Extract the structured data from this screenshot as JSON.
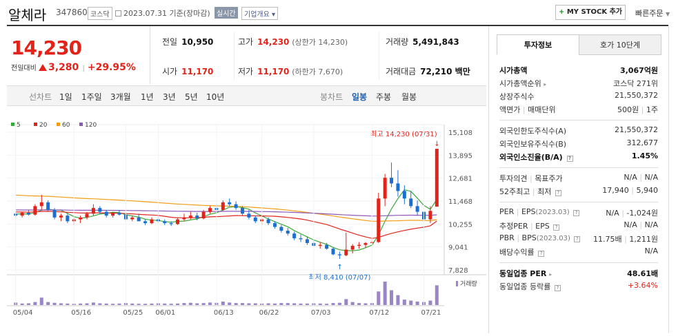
{
  "header": {
    "stock_name": "알체라",
    "stock_code": "347860",
    "market_badge": "코스닥",
    "date_text": "2023.07.31 기준(장마감)",
    "realtime_badge": "실시간",
    "company_overview": "기업개요",
    "mystock_plus": "+",
    "mystock_label": "MY STOCK 추가",
    "quick_order": "빠른주문"
  },
  "price": {
    "current": "14,230",
    "change_label": "전일대비",
    "change": "3,280",
    "change_pct": "+29.95%"
  },
  "stats": {
    "prev_label": "전일",
    "prev": "10,950",
    "high_label": "고가",
    "high": "14,230",
    "high_note": "(상한가 14,230)",
    "volume_label": "거래량",
    "volume": "5,491,843",
    "open_label": "시가",
    "open": "11,170",
    "low_label": "저가",
    "low": "11,170",
    "low_note": "(하한가 7,670)",
    "amount_label": "거래대금",
    "amount": "72,210 백만"
  },
  "chart_controls": {
    "line_chart": "선차트",
    "periods": [
      "1일",
      "1주일",
      "3개월",
      "1년",
      "3년",
      "5년",
      "10년"
    ],
    "candle_chart": "봉차트",
    "candle_periods": [
      "일봉",
      "주봉",
      "월봉"
    ],
    "selected_candle": "일봉"
  },
  "chart_data": {
    "type": "candlestick",
    "legend": [
      {
        "name": "5",
        "color": "#3aa83a"
      },
      {
        "name": "20",
        "color": "#e2231a"
      },
      {
        "name": "60",
        "color": "#f39c12"
      },
      {
        "name": "120",
        "color": "#8e58b8"
      }
    ],
    "y_ticks": [
      "15,108",
      "13,895",
      "12,681",
      "11,468",
      "10,255",
      "9,041",
      "7,828"
    ],
    "ylim": [
      7828,
      15108
    ],
    "x_ticks": [
      "05/04",
      "05/16",
      "05/25",
      "06/01",
      "06/13",
      "06/22",
      "07/03",
      "07/12",
      "07/21"
    ],
    "high_annotation": "최고 14,230 (07/31)",
    "low_annotation": "최저 8,410 (07/07)",
    "volume_label": "거래량",
    "candles": [
      [
        10800,
        10900,
        10600,
        10700
      ],
      [
        10700,
        10900,
        10600,
        10850
      ],
      [
        10850,
        11000,
        10700,
        10750
      ],
      [
        10750,
        11300,
        10700,
        11200
      ],
      [
        11200,
        11800,
        11000,
        11400
      ],
      [
        11400,
        11500,
        10900,
        11000
      ],
      [
        11000,
        11100,
        10500,
        10600
      ],
      [
        10600,
        10800,
        10400,
        10700
      ],
      [
        10700,
        10800,
        10300,
        10400
      ],
      [
        10400,
        10600,
        10200,
        10500
      ],
      [
        10500,
        10700,
        10300,
        10600
      ],
      [
        10600,
        10900,
        10500,
        10800
      ],
      [
        10800,
        11300,
        10700,
        11100
      ],
      [
        11100,
        11200,
        10800,
        10900
      ],
      [
        10900,
        11000,
        10600,
        10700
      ],
      [
        10700,
        10900,
        10600,
        10850
      ],
      [
        10850,
        11000,
        10700,
        10750
      ],
      [
        10750,
        10800,
        10400,
        10500
      ],
      [
        10500,
        10700,
        10400,
        10600
      ],
      [
        10600,
        10800,
        10500,
        10400
      ],
      [
        10400,
        10500,
        10200,
        10300
      ],
      [
        10300,
        10600,
        10250,
        10500
      ],
      [
        10500,
        10700,
        10300,
        10400
      ],
      [
        10400,
        10500,
        10200,
        10300
      ],
      [
        10300,
        10400,
        10150,
        10250
      ],
      [
        10250,
        10600,
        10200,
        10500
      ],
      [
        10500,
        10800,
        10400,
        10600
      ],
      [
        10600,
        10900,
        10500,
        10700
      ],
      [
        10700,
        10850,
        10450,
        10550
      ],
      [
        10550,
        11000,
        10500,
        10900
      ],
      [
        10900,
        11200,
        10800,
        11100
      ],
      [
        11100,
        11300,
        10900,
        11000
      ],
      [
        11000,
        11500,
        10950,
        11400
      ],
      [
        11400,
        11600,
        11200,
        11300
      ],
      [
        11300,
        11450,
        11000,
        11100
      ],
      [
        11100,
        11200,
        10700,
        10800
      ],
      [
        10800,
        11000,
        10500,
        10600
      ],
      [
        10600,
        10700,
        10300,
        10400
      ],
      [
        10400,
        10700,
        10200,
        10500
      ],
      [
        10500,
        10600,
        10200,
        10300
      ],
      [
        10300,
        10400,
        10000,
        10100
      ],
      [
        10100,
        10200,
        9800,
        9900
      ],
      [
        9900,
        10050,
        9650,
        9750
      ],
      [
        9750,
        9850,
        9400,
        9500
      ],
      [
        9500,
        9700,
        9300,
        9450
      ],
      [
        9450,
        9600,
        9150,
        9250
      ],
      [
        9250,
        9400,
        9050,
        9100
      ],
      [
        9100,
        9300,
        8950,
        9150
      ],
      [
        9150,
        9250,
        8900,
        8950
      ],
      [
        8950,
        9000,
        8600,
        8650
      ],
      [
        8650,
        8800,
        8410,
        8600
      ],
      [
        8600,
        9800,
        8550,
        8900
      ],
      [
        8900,
        9200,
        8700,
        9100
      ],
      [
        9100,
        9300,
        8950,
        9150
      ],
      [
        9150,
        9300,
        9000,
        9250
      ],
      [
        9250,
        9450,
        9100,
        9300
      ],
      [
        9300,
        11900,
        9250,
        11600
      ],
      [
        11600,
        12900,
        11200,
        12700
      ],
      [
        12700,
        13500,
        12200,
        12400
      ],
      [
        12400,
        13100,
        11700,
        12000
      ],
      [
        12000,
        12300,
        11300,
        11600
      ],
      [
        11600,
        12000,
        11100,
        11200
      ],
      [
        11200,
        11500,
        10700,
        10900
      ],
      [
        10900,
        11100,
        10400,
        10500
      ],
      [
        10500,
        11200,
        10300,
        10950
      ],
      [
        11170,
        14230,
        11170,
        14230
      ]
    ],
    "volumes": [
      10,
      6,
      7,
      12,
      30,
      12,
      9,
      7,
      6,
      5,
      6,
      7,
      10,
      7,
      6,
      5,
      6,
      8,
      6,
      5,
      5,
      6,
      7,
      6,
      5,
      6,
      8,
      9,
      7,
      8,
      10,
      9,
      14,
      10,
      8,
      8,
      7,
      7,
      6,
      7,
      6,
      8,
      8,
      7,
      6,
      6,
      7,
      6,
      5,
      8,
      9,
      24,
      12,
      8,
      7,
      8,
      55,
      95,
      60,
      40,
      22,
      18,
      14,
      12,
      18,
      80
    ]
  },
  "side": {
    "tab_invest": "투자정보",
    "tab_hoga": "호가 10단계",
    "r1k": "시가총액",
    "r1v": "3,067억원",
    "r2k": "시가총액순위",
    "r2v": "코스닥 271위",
    "r3k": "상장주식수",
    "r3v": "21,550,372",
    "r4k": "액면가",
    "r4k2": "매매단위",
    "r4v": "500원",
    "r4v2": "1주",
    "r5k": "외국인한도주식수(A)",
    "r5v": "21,550,372",
    "r6k": "외국인보유주식수(B)",
    "r6v": "312,677",
    "r7k": "외국인소진율(B/A)",
    "r7v": "1.45%",
    "r8k": "투자의견",
    "r8k2": "목표주가",
    "r8v": "N/A",
    "r8v2": "N/A",
    "r9k": "52주최고",
    "r9k2": "최저",
    "r9v": "17,940",
    "r9v2": "5,940",
    "r10k": "PER",
    "r10k2": "EPS",
    "r10y": "(2023.03)",
    "r10v": "N/A",
    "r10v2": "-1,024원",
    "r11k": "추정PER",
    "r11k2": "EPS",
    "r11v": "N/A",
    "r11v2": "N/A",
    "r12k": "PBR",
    "r12k2": "BPS",
    "r12y": "(2023.03)",
    "r12v": "11.75배",
    "r12v2": "1,211원",
    "r13k": "배당수익률",
    "r13v": "N/A",
    "r14k": "동일업종 PER",
    "r14v": "48.61배",
    "r15k": "동일업종 등락률",
    "r15v": "+3.64%"
  }
}
